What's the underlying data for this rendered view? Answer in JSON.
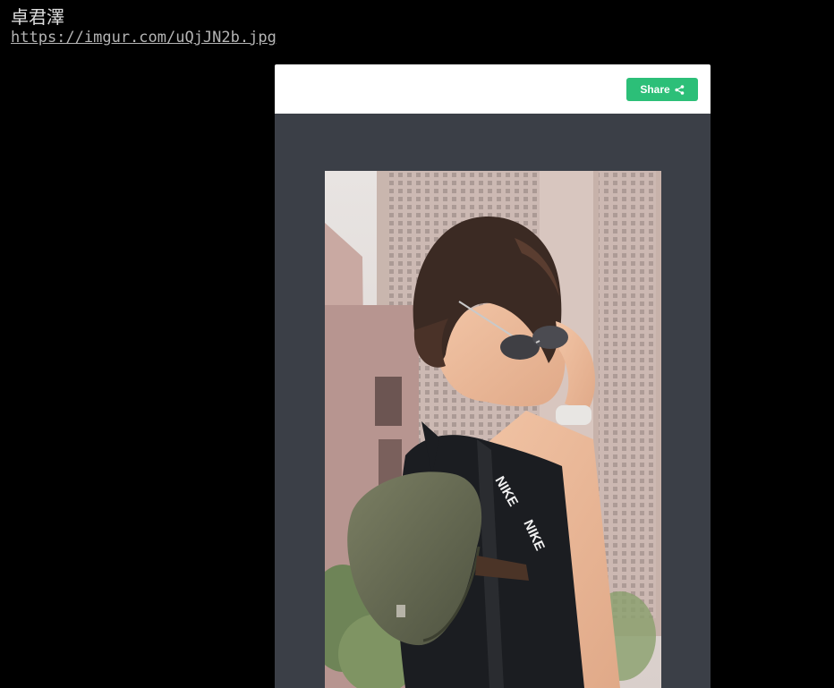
{
  "post": {
    "title": "卓君澤",
    "link_text": "https://imgur.com/uQjJN2b.jpg"
  },
  "embed": {
    "share_label": "Share",
    "share_icon": "share-icon",
    "accent_color": "#2cbf78",
    "photo_alt": "Woman with short hair holding sunglasses, wearing a black top and an olive crossbody bag with NIKE strap, city buildings behind",
    "strap_text": "NIKE"
  }
}
